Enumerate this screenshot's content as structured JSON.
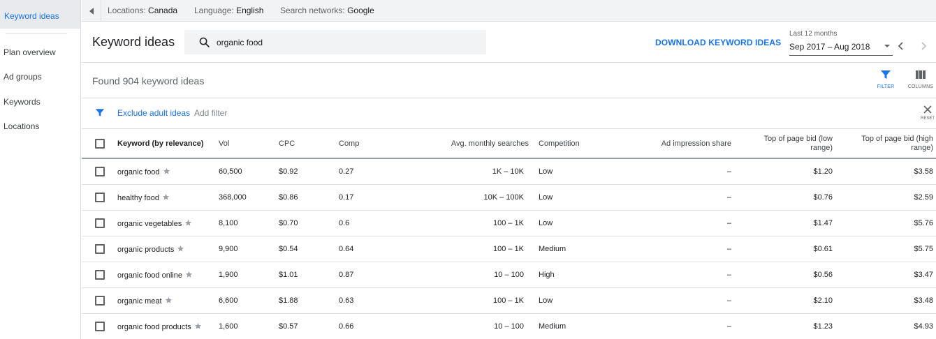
{
  "sidebar": {
    "active": "Keyword ideas",
    "items": [
      "Plan overview",
      "Ad groups",
      "Keywords",
      "Locations"
    ]
  },
  "topbar": {
    "locations_label": "Locations:",
    "locations_value": "Canada",
    "language_label": "Language:",
    "language_value": "English",
    "networks_label": "Search networks:",
    "networks_value": "Google"
  },
  "header": {
    "title": "Keyword ideas",
    "search_value": "organic food",
    "download_label": "DOWNLOAD KEYWORD IDEAS",
    "range_caption": "Last 12 months",
    "range_value": "Sep 2017 – Aug 2018"
  },
  "results": {
    "found_text": "Found 904 keyword ideas",
    "filter_label": "FILTER",
    "columns_label": "COLUMNS"
  },
  "filters": {
    "exclude_adult": "Exclude adult ideas",
    "add_filter": "Add filter",
    "reset_label": "RESET"
  },
  "table": {
    "headers": {
      "keyword": "Keyword (by relevance)",
      "vol": "Vol",
      "cpc": "CPC",
      "comp": "Comp",
      "avg": "Avg. monthly searches",
      "competition": "Competition",
      "impression": "Ad impression share",
      "bid_low_1": "Top of page bid (low",
      "bid_low_2": "range)",
      "bid_high_1": "Top of page bid (high",
      "bid_high_2": "range)"
    },
    "rows": [
      {
        "keyword": "organic food",
        "vol": "60,500",
        "cpc": "$0.92",
        "comp": "0.27",
        "avg": "1K – 10K",
        "competition": "Low",
        "impression": "–",
        "bid_low": "$1.20",
        "bid_high": "$3.58"
      },
      {
        "keyword": "healthy food",
        "vol": "368,000",
        "cpc": "$0.86",
        "comp": "0.17",
        "avg": "10K – 100K",
        "competition": "Low",
        "impression": "–",
        "bid_low": "$0.76",
        "bid_high": "$2.59"
      },
      {
        "keyword": "organic vegetables",
        "vol": "8,100",
        "cpc": "$0.70",
        "comp": "0.6",
        "avg": "100 – 1K",
        "competition": "Low",
        "impression": "–",
        "bid_low": "$1.47",
        "bid_high": "$5.76"
      },
      {
        "keyword": "organic products",
        "vol": "9,900",
        "cpc": "$0.54",
        "comp": "0.64",
        "avg": "100 – 1K",
        "competition": "Medium",
        "impression": "–",
        "bid_low": "$0.61",
        "bid_high": "$5.75"
      },
      {
        "keyword": "organic food online",
        "vol": "1,900",
        "cpc": "$1.01",
        "comp": "0.87",
        "avg": "10 – 100",
        "competition": "High",
        "impression": "–",
        "bid_low": "$0.56",
        "bid_high": "$3.47"
      },
      {
        "keyword": "organic meat",
        "vol": "6,600",
        "cpc": "$1.88",
        "comp": "0.63",
        "avg": "100 – 1K",
        "competition": "Low",
        "impression": "–",
        "bid_low": "$2.10",
        "bid_high": "$3.48"
      },
      {
        "keyword": "organic food products",
        "vol": "1,600",
        "cpc": "$0.57",
        "comp": "0.66",
        "avg": "10 – 100",
        "competition": "Medium",
        "impression": "–",
        "bid_low": "$1.23",
        "bid_high": "$4.93"
      }
    ]
  },
  "colors": {
    "accent": "#1a73e8",
    "sidebar_active_bg": "#e8eaed",
    "topbar_bg": "#f1f3f4"
  },
  "icons": [
    "chevron-left-icon",
    "search-icon",
    "caret-down-icon",
    "chevron-right-icon",
    "filter-icon",
    "columns-icon",
    "close-icon",
    "star-icon"
  ]
}
